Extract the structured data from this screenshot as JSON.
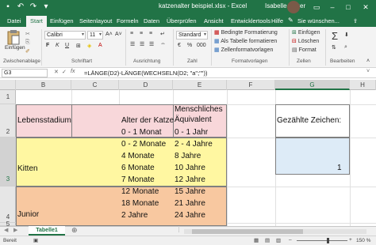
{
  "titlebar": {
    "title": "katzenalter beispiel.xlsx  -  Excel",
    "user": "Isabelle Bauer",
    "icons": [
      "save-icon",
      "undo-icon",
      "redo-icon",
      "customize-icon",
      "ribbon-display-icon",
      "minimize-icon",
      "maximize-icon",
      "close-icon"
    ]
  },
  "tabs": [
    "Datei",
    "Start",
    "Einfügen",
    "Seitenlayout",
    "Formeln",
    "Daten",
    "Überprüfen",
    "Ansicht",
    "Entwicklertools",
    "Hilfe"
  ],
  "active_tab": "Start",
  "tell_me": "Sie wünschen...",
  "ribbon": {
    "paste_label": "Einfügen",
    "font_name": "Calibri",
    "font_size": "11",
    "number_format": "Standard",
    "cond_format": "Bedingte Formatierung",
    "as_table": "Als Tabelle formatieren",
    "cell_styles": "Zellenformatvorlagen",
    "insert": "Einfügen",
    "delete": "Löschen",
    "format": "Format",
    "groups": {
      "clipboard": "Zwischenablage",
      "font": "Schriftart",
      "alignment": "Ausrichtung",
      "number": "Zahl",
      "styles": "Formatvorlagen",
      "cells": "Zellen",
      "editing": "Bearbeiten"
    },
    "font_buttons": [
      "F",
      "K",
      "U"
    ]
  },
  "formula_bar": {
    "name_box": "G3",
    "fx": "fx",
    "formula": "=LÄNGE(D2)-LÄNGE(WECHSELN(D2; \"a\";\"\"))"
  },
  "columns": [
    "B",
    "C",
    "D",
    "E",
    "F",
    "G",
    "H"
  ],
  "selected_column": "G",
  "rows": [
    "1",
    "2",
    "3",
    "4",
    "5"
  ],
  "selected_row": "3",
  "cells": {
    "b2": "Lebensstadium",
    "d2": "Alter der Katze",
    "e2a": "Menschliches",
    "e2b": "Äquivalent",
    "g2": "Gezählte Zeichen:",
    "b3": "Kitten",
    "g3": "1",
    "b4": "Junior",
    "d_kitten": [
      "0 - 1 Monat",
      "0 - 2 Monate",
      "4 Monate",
      "6 Monate"
    ],
    "e_kitten": [
      "0 - 1 Jahr",
      "2 - 4 Jahre",
      "8 Jahre",
      "10 Jahre"
    ],
    "d_junior": [
      "7 Monate",
      "12 Monate",
      "18 Monate",
      "2 Jahre"
    ],
    "e_junior": [
      "12 Jahre",
      "15 Jahre",
      "21 Jahre",
      "24 Jahre"
    ]
  },
  "colors": {
    "excel_green": "#217346",
    "header_pink": "#f8d7da",
    "kitten_yellow": "#fff7a1",
    "junior_orange": "#f8c8a0",
    "g_blue": "#ddebf7"
  },
  "sheet_tab": "Tabelle1",
  "status": {
    "left": "Bereit",
    "zoom": "150 %"
  }
}
